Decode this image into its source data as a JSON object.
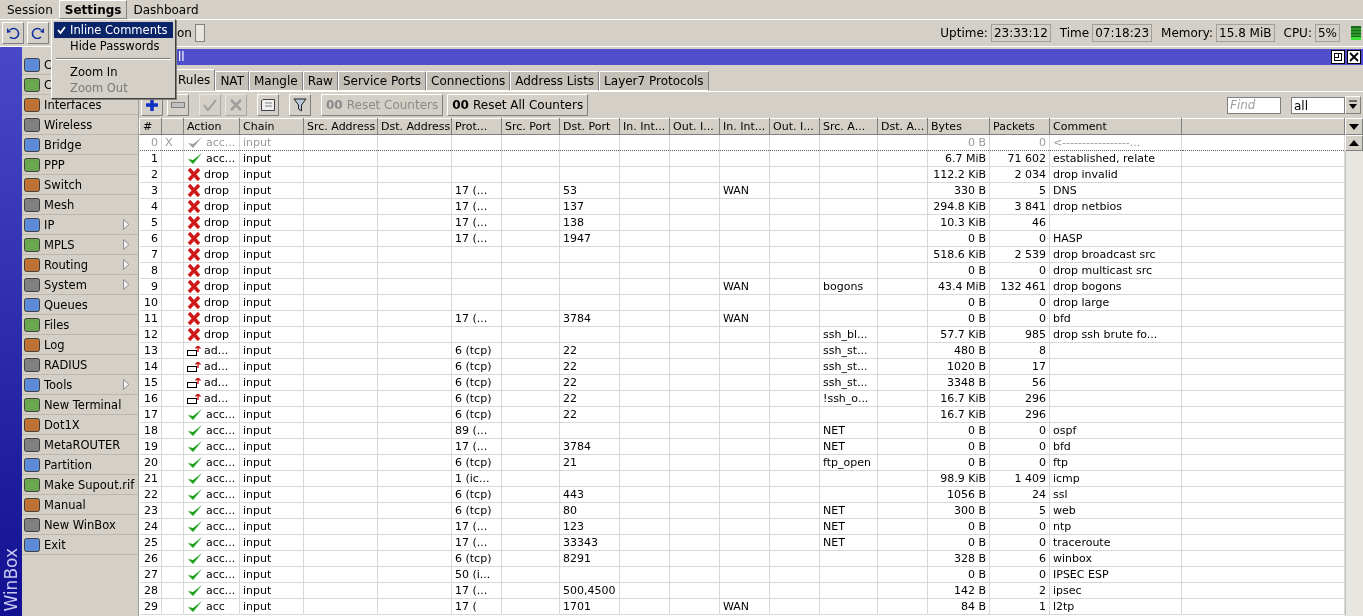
{
  "menubar": [
    {
      "label": "Session",
      "selected": false
    },
    {
      "label": "Settings",
      "selected": true
    },
    {
      "label": "Dashboard",
      "selected": false
    }
  ],
  "settings_menu": [
    {
      "kind": "item",
      "label": "Inline Comments",
      "checked": true,
      "selected": true,
      "disabled": false
    },
    {
      "kind": "item",
      "label": "Hide Passwords",
      "checked": false,
      "selected": false,
      "disabled": false
    },
    {
      "kind": "separator"
    },
    {
      "kind": "item",
      "label": "Zoom In",
      "checked": false,
      "selected": false,
      "disabled": false
    },
    {
      "kind": "item",
      "label": "Zoom Out",
      "checked": false,
      "selected": false,
      "disabled": true
    }
  ],
  "toolbar": {
    "safe_mode_label": "on",
    "safe_mode_checked": false
  },
  "status": [
    {
      "label": "Uptime:",
      "value": "23:33:12"
    },
    {
      "label": "Time",
      "value": "07:18:23"
    },
    {
      "label": "Memory:",
      "value": "15.8 MiB"
    },
    {
      "label": "CPU:",
      "value": "5%"
    }
  ],
  "sidebar": {
    "brand": "WinBox",
    "items": [
      {
        "label": "C",
        "submenu": false
      },
      {
        "label": "C",
        "submenu": false
      },
      {
        "label": "Interfaces",
        "submenu": false
      },
      {
        "label": "Wireless",
        "submenu": false
      },
      {
        "label": "Bridge",
        "submenu": false
      },
      {
        "label": "PPP",
        "submenu": false
      },
      {
        "label": "Switch",
        "submenu": false
      },
      {
        "label": "Mesh",
        "submenu": false
      },
      {
        "label": "IP",
        "submenu": true
      },
      {
        "label": "MPLS",
        "submenu": true
      },
      {
        "label": "Routing",
        "submenu": true
      },
      {
        "label": "System",
        "submenu": true
      },
      {
        "label": "Queues",
        "submenu": false
      },
      {
        "label": "Files",
        "submenu": false
      },
      {
        "label": "Log",
        "submenu": false
      },
      {
        "label": "RADIUS",
        "submenu": false
      },
      {
        "label": "Tools",
        "submenu": true
      },
      {
        "label": "New Terminal",
        "submenu": false
      },
      {
        "label": "Dot1X",
        "submenu": false
      },
      {
        "label": "MetaROUTER",
        "submenu": false
      },
      {
        "label": "Partition",
        "submenu": false
      },
      {
        "label": "Make Supout.rif",
        "submenu": false
      },
      {
        "label": "Manual",
        "submenu": false
      },
      {
        "label": "New WinBox",
        "submenu": false
      },
      {
        "label": "Exit",
        "submenu": false
      }
    ]
  },
  "window": {
    "title": "ll",
    "tabs": [
      {
        "label": "Rules",
        "selected": true
      },
      {
        "label": "NAT",
        "selected": false
      },
      {
        "label": "Mangle",
        "selected": false
      },
      {
        "label": "Raw",
        "selected": false
      },
      {
        "label": "Service Ports",
        "selected": false
      },
      {
        "label": "Connections",
        "selected": false
      },
      {
        "label": "Address Lists",
        "selected": false
      },
      {
        "label": "Layer7 Protocols",
        "selected": false
      }
    ],
    "tools": [
      {
        "kind": "add",
        "disabled": false
      },
      {
        "kind": "remove",
        "disabled": false
      },
      {
        "kind": "enable",
        "disabled": true
      },
      {
        "kind": "disable",
        "disabled": true
      },
      {
        "kind": "comment",
        "disabled": false
      },
      {
        "kind": "filter",
        "disabled": false
      }
    ],
    "counter_buttons": [
      {
        "prefix": "00",
        "label": "Reset Counters",
        "disabled": true
      },
      {
        "prefix": "00",
        "label": "Reset All Counters",
        "disabled": false
      }
    ],
    "find": {
      "placeholder": "Find"
    },
    "filter": {
      "value": "all"
    }
  },
  "table": {
    "columns": [
      "#",
      "Action",
      "Chain",
      "Src. Address",
      "Dst. Address",
      "Prot...",
      "Src. Port",
      "Dst. Port",
      "In. Int...",
      "Out. I...",
      "In. Int...",
      "Out. I...",
      "Src. A...",
      "Dst. A...",
      "Bytes",
      "Packets",
      "Comment"
    ],
    "rows": [
      {
        "num": "0",
        "flag": "X",
        "disabled": true,
        "action": {
          "kind": "accept",
          "label": "acc..."
        },
        "chain": "input",
        "bytes": "0 B",
        "packets": "0",
        "comment": "<-----------------..."
      },
      {
        "num": "1",
        "disabled": false,
        "action": {
          "kind": "accept",
          "label": "acc..."
        },
        "chain": "input",
        "bytes": "6.7 MiB",
        "packets": "71 602",
        "comment": "established, relate"
      },
      {
        "num": "2",
        "disabled": false,
        "action": {
          "kind": "drop",
          "label": "drop"
        },
        "chain": "input",
        "bytes": "112.2 KiB",
        "packets": "2 034",
        "comment": "drop invalid"
      },
      {
        "num": "3",
        "disabled": false,
        "action": {
          "kind": "drop",
          "label": "drop"
        },
        "chain": "input",
        "protocol": "17 (...",
        "dst_port": "53",
        "in_list": "WAN",
        "bytes": "330 B",
        "packets": "5",
        "comment": "DNS"
      },
      {
        "num": "4",
        "disabled": false,
        "action": {
          "kind": "drop",
          "label": "drop"
        },
        "chain": "input",
        "protocol": "17 (...",
        "dst_port": "137",
        "bytes": "294.8 KiB",
        "packets": "3 841",
        "comment": "drop netbios"
      },
      {
        "num": "5",
        "disabled": false,
        "action": {
          "kind": "drop",
          "label": "drop"
        },
        "chain": "input",
        "protocol": "17 (...",
        "dst_port": "138",
        "bytes": "10.3 KiB",
        "packets": "46"
      },
      {
        "num": "6",
        "disabled": false,
        "action": {
          "kind": "drop",
          "label": "drop"
        },
        "chain": "input",
        "protocol": "17 (...",
        "dst_port": "1947",
        "bytes": "0 B",
        "packets": "0",
        "comment": "HASP"
      },
      {
        "num": "7",
        "disabled": false,
        "action": {
          "kind": "drop",
          "label": "drop"
        },
        "chain": "input",
        "bytes": "518.6 KiB",
        "packets": "2 539",
        "comment": "drop broadcast src"
      },
      {
        "num": "8",
        "disabled": false,
        "action": {
          "kind": "drop",
          "label": "drop"
        },
        "chain": "input",
        "bytes": "0 B",
        "packets": "0",
        "comment": "drop multicast src"
      },
      {
        "num": "9",
        "disabled": false,
        "action": {
          "kind": "drop",
          "label": "drop"
        },
        "chain": "input",
        "in_list": "WAN",
        "src_list": "bogons",
        "bytes": "43.4 MiB",
        "packets": "132 461",
        "comment": "drop bogons"
      },
      {
        "num": "10",
        "disabled": false,
        "action": {
          "kind": "drop",
          "label": "drop"
        },
        "chain": "input",
        "bytes": "0 B",
        "packets": "0",
        "comment": "drop large"
      },
      {
        "num": "11",
        "disabled": false,
        "action": {
          "kind": "drop",
          "label": "drop"
        },
        "chain": "input",
        "protocol": "17 (...",
        "dst_port": "3784",
        "in_list": "WAN",
        "bytes": "0 B",
        "packets": "0",
        "comment": "bfd"
      },
      {
        "num": "12",
        "disabled": false,
        "action": {
          "kind": "drop",
          "label": "drop"
        },
        "chain": "input",
        "src_list": "ssh_bl...",
        "bytes": "57.7 KiB",
        "packets": "985",
        "comment": "drop ssh brute fo..."
      },
      {
        "num": "13",
        "disabled": false,
        "action": {
          "kind": "add",
          "label": "ad..."
        },
        "chain": "input",
        "protocol": "6 (tcp)",
        "dst_port": "22",
        "src_list": "ssh_st...",
        "bytes": "480 B",
        "packets": "8"
      },
      {
        "num": "14",
        "disabled": false,
        "action": {
          "kind": "add",
          "label": "ad..."
        },
        "chain": "input",
        "protocol": "6 (tcp)",
        "dst_port": "22",
        "src_list": "ssh_st...",
        "bytes": "1020 B",
        "packets": "17"
      },
      {
        "num": "15",
        "disabled": false,
        "action": {
          "kind": "add",
          "label": "ad..."
        },
        "chain": "input",
        "protocol": "6 (tcp)",
        "dst_port": "22",
        "src_list": "ssh_st...",
        "bytes": "3348 B",
        "packets": "56"
      },
      {
        "num": "16",
        "disabled": false,
        "action": {
          "kind": "add",
          "label": "ad..."
        },
        "chain": "input",
        "protocol": "6 (tcp)",
        "dst_port": "22",
        "src_list": "!ssh_o...",
        "bytes": "16.7 KiB",
        "packets": "296"
      },
      {
        "num": "17",
        "disabled": false,
        "action": {
          "kind": "accept",
          "label": "acc..."
        },
        "chain": "input",
        "protocol": "6 (tcp)",
        "dst_port": "22",
        "bytes": "16.7 KiB",
        "packets": "296"
      },
      {
        "num": "18",
        "disabled": false,
        "action": {
          "kind": "accept",
          "label": "acc..."
        },
        "chain": "input",
        "protocol": "89 (...",
        "src_list": "NET",
        "bytes": "0 B",
        "packets": "0",
        "comment": "ospf"
      },
      {
        "num": "19",
        "disabled": false,
        "action": {
          "kind": "accept",
          "label": "acc..."
        },
        "chain": "input",
        "protocol": "17 (...",
        "dst_port": "3784",
        "src_list": "NET",
        "bytes": "0 B",
        "packets": "0",
        "comment": "bfd"
      },
      {
        "num": "20",
        "disabled": false,
        "action": {
          "kind": "accept",
          "label": "acc..."
        },
        "chain": "input",
        "protocol": "6 (tcp)",
        "dst_port": "21",
        "src_list": "ftp_open",
        "bytes": "0 B",
        "packets": "0",
        "comment": "ftp"
      },
      {
        "num": "21",
        "disabled": false,
        "action": {
          "kind": "accept",
          "label": "acc..."
        },
        "chain": "input",
        "protocol": "1 (ic...",
        "bytes": "98.9 KiB",
        "packets": "1 409",
        "comment": "icmp"
      },
      {
        "num": "22",
        "disabled": false,
        "action": {
          "kind": "accept",
          "label": "acc..."
        },
        "chain": "input",
        "protocol": "6 (tcp)",
        "dst_port": "443",
        "bytes": "1056 B",
        "packets": "24",
        "comment": "ssl"
      },
      {
        "num": "23",
        "disabled": false,
        "action": {
          "kind": "accept",
          "label": "acc..."
        },
        "chain": "input",
        "protocol": "6 (tcp)",
        "dst_port": "80",
        "src_list": "NET",
        "bytes": "300 B",
        "packets": "5",
        "comment": "web"
      },
      {
        "num": "24",
        "disabled": false,
        "action": {
          "kind": "accept",
          "label": "acc..."
        },
        "chain": "input",
        "protocol": "17 (...",
        "dst_port": "123",
        "src_list": "NET",
        "bytes": "0 B",
        "packets": "0",
        "comment": "ntp"
      },
      {
        "num": "25",
        "disabled": false,
        "action": {
          "kind": "accept",
          "label": "acc..."
        },
        "chain": "input",
        "protocol": "17 (...",
        "dst_port": "33343",
        "src_list": "NET",
        "bytes": "0 B",
        "packets": "0",
        "comment": "traceroute"
      },
      {
        "num": "26",
        "disabled": false,
        "action": {
          "kind": "accept",
          "label": "acc..."
        },
        "chain": "input",
        "protocol": "6 (tcp)",
        "dst_port": "8291",
        "bytes": "328 B",
        "packets": "6",
        "comment": "winbox"
      },
      {
        "num": "27",
        "disabled": false,
        "action": {
          "kind": "accept",
          "label": "acc..."
        },
        "chain": "input",
        "protocol": "50 (i...",
        "bytes": "0 B",
        "packets": "0",
        "comment": "IPSEC ESP"
      },
      {
        "num": "28",
        "disabled": false,
        "action": {
          "kind": "accept",
          "label": "acc..."
        },
        "chain": "input",
        "protocol": "17 (...",
        "dst_port": "500,4500",
        "bytes": "142 B",
        "packets": "2",
        "comment": "ipsec"
      },
      {
        "num": "29",
        "disabled": false,
        "action": {
          "kind": "accept",
          "label": "acc"
        },
        "chain": "input",
        "protocol": "17 (",
        "dst_port": "1701",
        "in_list": "WAN",
        "bytes": "84 B",
        "packets": "1",
        "comment": "l2tp"
      }
    ]
  }
}
